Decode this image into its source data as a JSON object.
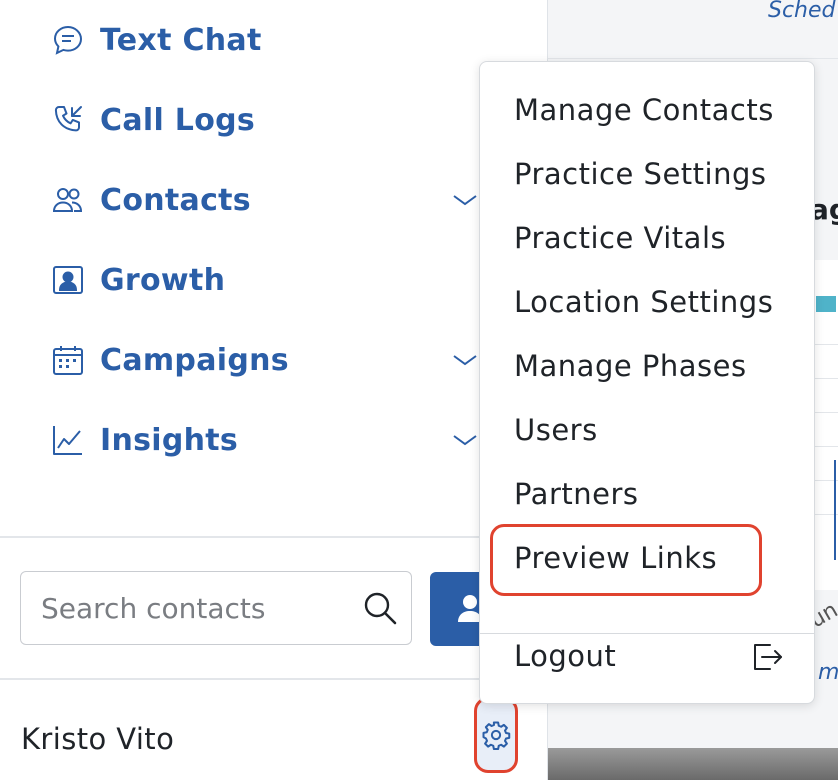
{
  "nav": {
    "items": [
      {
        "label": "Text Chat",
        "icon": "chat-bubble-icon"
      },
      {
        "label": "Call Logs",
        "icon": "phone-incoming-icon"
      },
      {
        "label": "Contacts",
        "icon": "users-icon",
        "expandable": true
      },
      {
        "label": "Growth",
        "icon": "contact-card-icon"
      },
      {
        "label": "Campaigns",
        "icon": "calendar-icon",
        "expandable": true
      },
      {
        "label": "Insights",
        "icon": "line-chart-icon",
        "expandable": true
      }
    ]
  },
  "search": {
    "placeholder": "Search contacts",
    "value": ""
  },
  "user": {
    "name": "Kristo Vito"
  },
  "menu": {
    "items": [
      "Manage Contacts",
      "Practice Settings",
      "Practice Vitals",
      "Location Settings",
      "Manage Phases",
      "Users",
      "Partners",
      "Preview Links"
    ],
    "logout": "Logout",
    "highlighted": "Preview Links"
  },
  "background": {
    "partial_texts": [
      "Sched",
      "ag",
      "un",
      "mp"
    ]
  },
  "colors": {
    "accent": "#2b5ea7",
    "highlight": "#e0432f",
    "text": "#1f2328"
  }
}
